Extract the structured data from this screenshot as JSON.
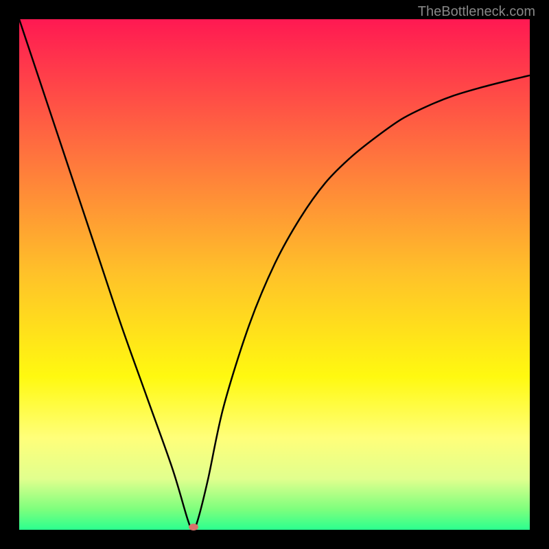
{
  "watermark": "TheBottleneck.com",
  "chart_data": {
    "type": "line",
    "title": "",
    "xlabel": "",
    "ylabel": "",
    "xlim": [
      0,
      100
    ],
    "ylim": [
      0,
      100
    ],
    "gradient_stops": [
      {
        "offset": 0,
        "color": "#ff1952"
      },
      {
        "offset": 25,
        "color": "#ff6e3f"
      },
      {
        "offset": 50,
        "color": "#ffc229"
      },
      {
        "offset": 70,
        "color": "#fff910"
      },
      {
        "offset": 82,
        "color": "#ffff7a"
      },
      {
        "offset": 90,
        "color": "#e1ff8e"
      },
      {
        "offset": 96,
        "color": "#7dff7d"
      },
      {
        "offset": 100,
        "color": "#2bff8f"
      }
    ],
    "series": [
      {
        "name": "bottleneck-curve",
        "x": [
          0,
          5,
          10,
          15,
          20,
          25,
          30,
          33,
          34,
          35,
          37,
          40,
          45,
          50,
          55,
          60,
          65,
          70,
          75,
          80,
          85,
          90,
          95,
          100
        ],
        "y": [
          100,
          85,
          70,
          55,
          40,
          26,
          12,
          2,
          0,
          2,
          10,
          24,
          40,
          52,
          61,
          68,
          73,
          77,
          80.5,
          83,
          85,
          86.5,
          87.8,
          89
        ]
      }
    ],
    "marker": {
      "x": 34.2,
      "y": 0.6
    }
  }
}
